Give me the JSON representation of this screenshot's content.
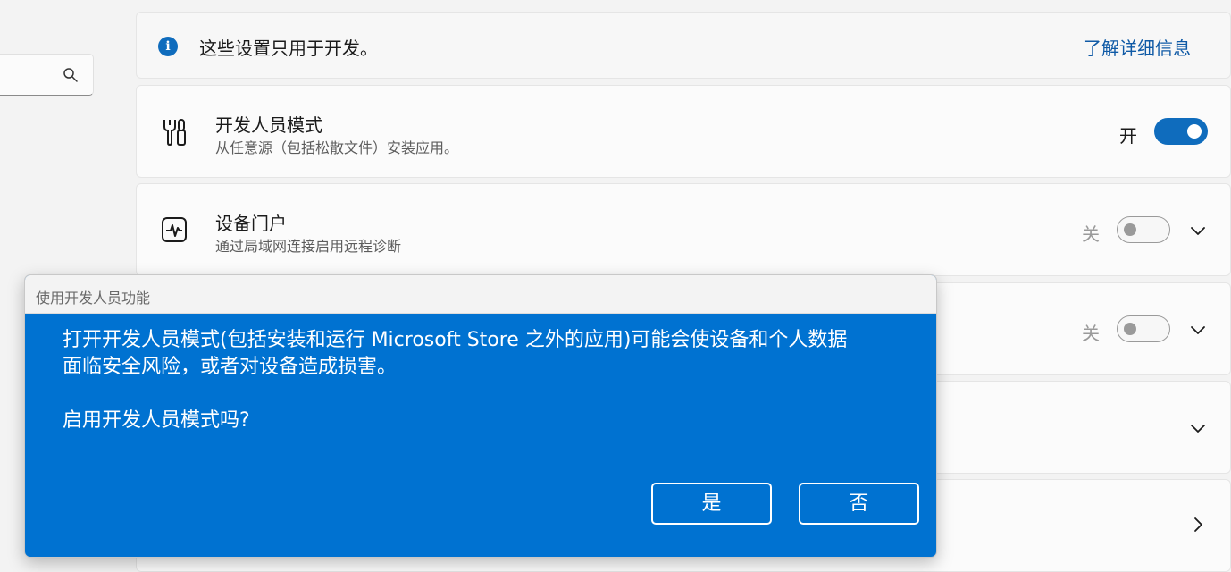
{
  "info": {
    "text": "这些设置只用于开发。",
    "link": "了解详细信息"
  },
  "developer_mode": {
    "title": "开发人员模式",
    "description": "从任意源（包括松散文件）安装应用。",
    "state_label": "开",
    "toggle_on": true
  },
  "device_portal": {
    "title": "设备门户",
    "description": "通过局域网连接启用远程诊断",
    "state_label": "关",
    "toggle_on": false
  },
  "row3": {
    "state_label": "关",
    "toggle_on": false
  },
  "dialog": {
    "title": "使用开发人员功能",
    "message_line1": "打开开发人员模式(包括安装和运行 Microsoft Store 之外的应用)可能会使设备和个人数据",
    "message_line2": "面临安全风险，或者对设备造成损害。",
    "question": "启用开发人员模式吗?",
    "yes_label": "是",
    "no_label": "否"
  },
  "colors": {
    "accent": "#0f6cbd",
    "dialog_blue": "#0072d1",
    "link": "#0f5aa6"
  },
  "icons": [
    "search-icon",
    "info-icon",
    "tools-icon",
    "pulse-icon",
    "chevron-down-icon",
    "chevron-right-icon"
  ]
}
